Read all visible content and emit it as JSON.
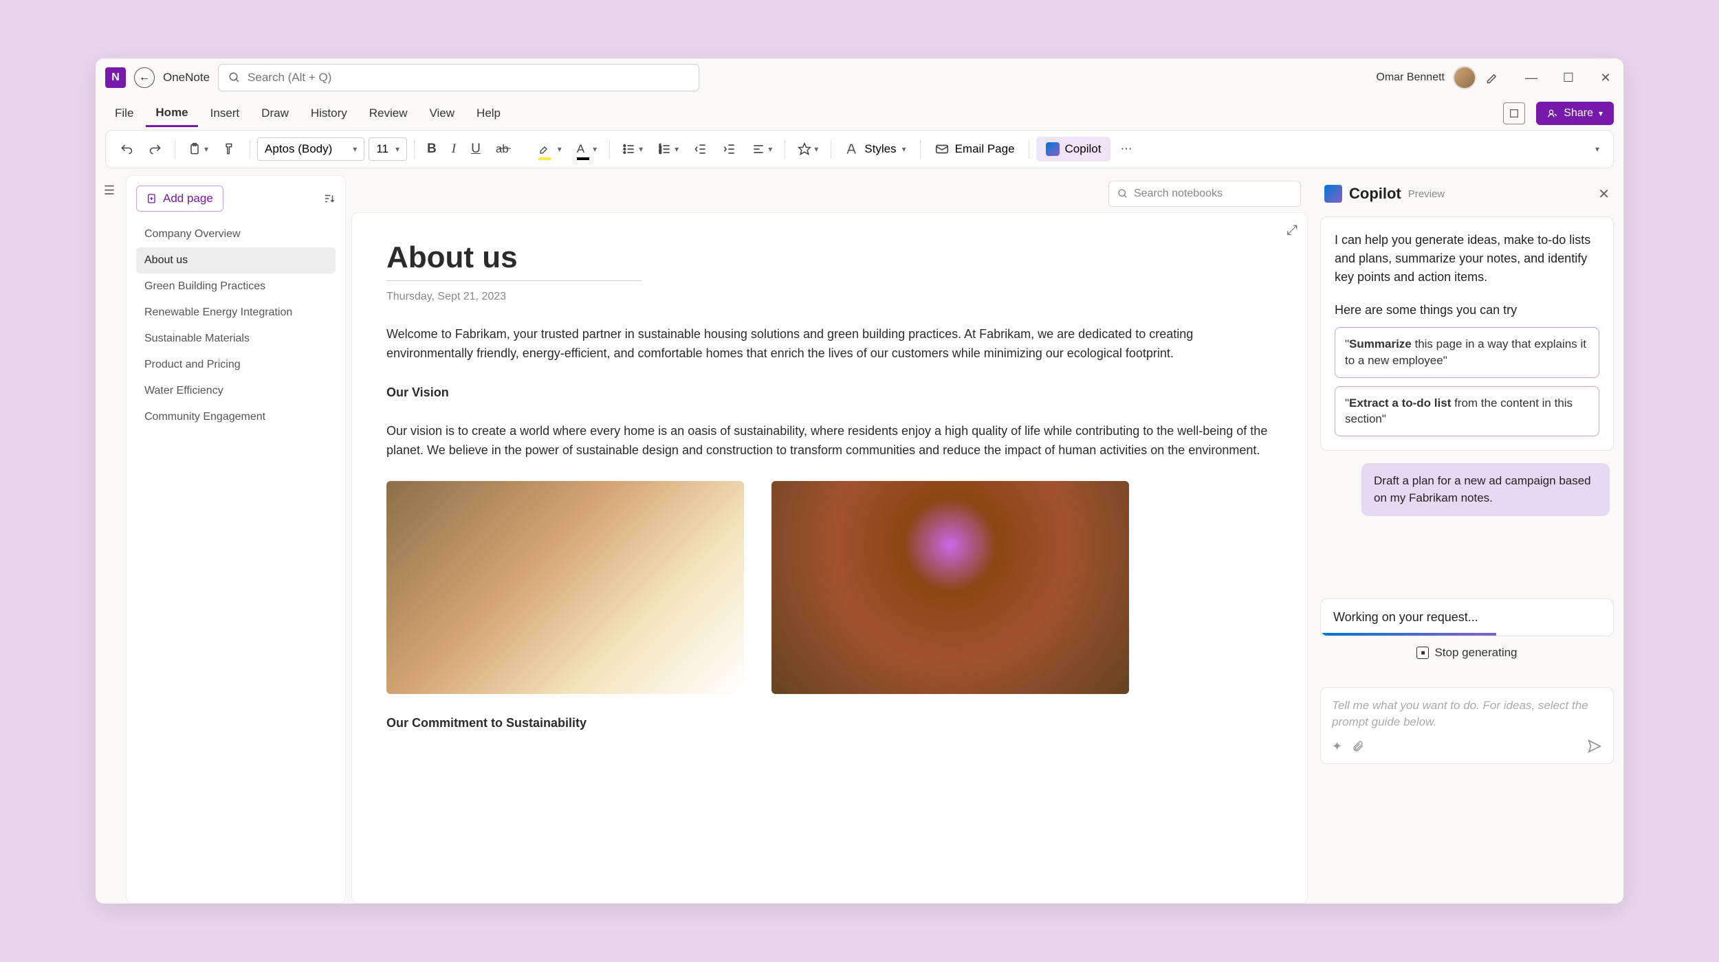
{
  "app": {
    "name": "OneNote"
  },
  "search": {
    "placeholder": "Search (Alt + Q)"
  },
  "user": {
    "name": "Omar Bennett"
  },
  "menu": [
    "File",
    "Home",
    "Insert",
    "Draw",
    "History",
    "Review",
    "View",
    "Help"
  ],
  "menuActive": "Home",
  "share": {
    "label": "Share"
  },
  "toolbar": {
    "font": "Aptos (Body)",
    "size": "11",
    "styles": "Styles",
    "emailPage": "Email Page",
    "copilot": "Copilot"
  },
  "searchNotebooks": {
    "placeholder": "Search notebooks"
  },
  "pagesPanel": {
    "addPage": "Add page",
    "items": [
      "Company Overview",
      "About us",
      "Green Building Practices",
      "Renewable Energy Integration",
      "Sustainable Materials",
      "Product and Pricing",
      "Water Efficiency",
      "Community Engagement"
    ],
    "activeIndex": 1
  },
  "note": {
    "title": "About us",
    "date": "Thursday, Sept 21, 2023",
    "intro": "Welcome to Fabrikam, your trusted partner in sustainable housing solutions and green building practices. At Fabrikam, we are dedicated to creating environmentally friendly, energy-efficient, and comfortable homes that enrich the lives of our customers while minimizing our ecological footprint.",
    "h1": "Our Vision",
    "vision": "Our vision is to create a world where every home is an oasis of sustainability, where residents enjoy a high quality of life while contributing to the well-being of the planet. We believe in the power of sustainable design and construction to transform communities and reduce the impact of human activities on the environment.",
    "h2": "Our Commitment to Sustainability"
  },
  "copilot": {
    "title": "Copilot",
    "preview": "Preview",
    "intro": "I can help you generate ideas, make to-do lists and plans, summarize your notes, and identify key points and action items.",
    "sub": "Here are some things you can try",
    "s1_bold": "Summarize",
    "s1_rest": " this page in a way that explains it to a new employee\"",
    "s2_bold": "Extract a to-do list",
    "s2_rest": " from the content in this section\"",
    "userMsg": "Draft a plan for a new ad campaign based on my Fabrikam notes.",
    "working": "Working on your request...",
    "stop": "Stop generating",
    "inputPlaceholder": "Tell me what you want to do. For ideas, select the prompt guide below."
  }
}
